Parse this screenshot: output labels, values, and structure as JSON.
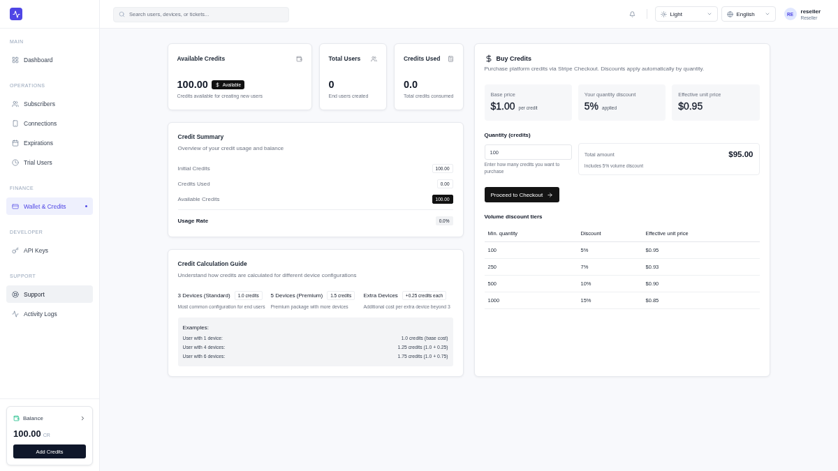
{
  "sidebar": {
    "sections": [
      {
        "heading": "MAIN",
        "items": [
          {
            "label": "Dashboard",
            "selected": false,
            "hovered": false
          }
        ]
      },
      {
        "heading": "OPERATIONS",
        "items": [
          {
            "label": "Subscribers",
            "selected": false,
            "hovered": false
          },
          {
            "label": "Connections",
            "selected": false,
            "hovered": false
          },
          {
            "label": "Expirations",
            "selected": false,
            "hovered": false
          },
          {
            "label": "Trial Users",
            "selected": false,
            "hovered": false
          }
        ]
      },
      {
        "heading": "FINANCE",
        "items": [
          {
            "label": "Wallet & Credits",
            "selected": true,
            "hovered": false
          }
        ]
      },
      {
        "heading": "DEVELOPER",
        "items": [
          {
            "label": "API Keys",
            "selected": false,
            "hovered": false
          }
        ]
      },
      {
        "heading": "SUPPORT",
        "items": [
          {
            "label": "Support",
            "selected": false,
            "hovered": true
          },
          {
            "label": "Activity Logs",
            "selected": false,
            "hovered": false
          }
        ]
      }
    ],
    "balance_card": {
      "label": "Balance",
      "amount": "100.00",
      "unit": "CR",
      "button": "Add Credits"
    }
  },
  "header": {
    "search": {
      "placeholder": "Search users, devices, or tickets..."
    },
    "theme_select": {
      "value": "Light"
    },
    "language_select": {
      "value": "English"
    },
    "user": {
      "initials": "RE",
      "name": "reseller",
      "role": "Reseller"
    }
  },
  "stat_cards": [
    {
      "title": "Available Credits",
      "value": "100.00",
      "badge": "Available",
      "description": "Credits available for creating new users"
    },
    {
      "title": "Total Users",
      "value": "0",
      "description": "End users created"
    },
    {
      "title": "Credits Used",
      "value": "0.0",
      "description": "Total credits consumed"
    }
  ],
  "credit_summary": {
    "title": "Credit Summary",
    "subtitle": "Overview of your credit usage and balance",
    "rows": [
      {
        "label": "Initial Credits",
        "value": "100.00",
        "kind": "outline"
      },
      {
        "label": "Credits Used",
        "value": "0.00",
        "kind": "outline"
      },
      {
        "label": "Available Credits",
        "value": "100.00",
        "kind": "solid"
      }
    ],
    "usage_rate": {
      "label": "Usage Rate",
      "value": "0.0%",
      "kind": "muted"
    }
  },
  "calculation_guide": {
    "title": "Credit Calculation Guide",
    "subtitle": "Understand how credits are calculated for different device configurations",
    "tiers": [
      {
        "name": "3 Devices (Standard)",
        "credits": "1.0 credits",
        "description": "Most common configuration for end users"
      },
      {
        "name": "5 Devices (Premium)",
        "credits": "1.5 credits",
        "description": "Premium package with more devices"
      },
      {
        "name": "Extra Devices",
        "credits": "+0.25 credits each",
        "description": "Additional cost per extra device beyond 3"
      }
    ],
    "examples": {
      "heading": "Examples:",
      "rows": [
        {
          "label": "User with 1 device:",
          "value": "1.0 credits (base cost)"
        },
        {
          "label": "User with 4 devices:",
          "value": "1.25 credits (1.0 + 0.25)"
        },
        {
          "label": "User with 6 devices:",
          "value": "1.75 credits (1.0 + 0.75)"
        }
      ]
    }
  },
  "buy_credits": {
    "title": "Buy Credits",
    "subtitle": "Purchase platform credits via Stripe Checkout. Discounts apply automatically by quantity.",
    "prices": [
      {
        "label": "Base price",
        "value": "$1.00",
        "suffix": "per credit"
      },
      {
        "label": "Your quantity discount",
        "value": "5%",
        "suffix": "applied"
      },
      {
        "label": "Effective unit price",
        "value": "$0.95"
      }
    ],
    "quantity": {
      "label": "Quantity (credits)",
      "value": "100",
      "hint": "Enter how many credits you want to purchase"
    },
    "total": {
      "label": "Total amount",
      "value": "$95.00",
      "note": "Includes 5% volume discount"
    },
    "checkout_button": "Proceed to Checkout",
    "tiers_table": {
      "title": "Volume discount tiers",
      "columns": [
        "Min. quantity",
        "Discount",
        "Effective unit price"
      ],
      "rows": [
        [
          "100",
          "5%",
          "$0.95"
        ],
        [
          "250",
          "7%",
          "$0.93"
        ],
        [
          "500",
          "10%",
          "$0.90"
        ],
        [
          "1000",
          "15%",
          "$0.85"
        ]
      ]
    }
  }
}
